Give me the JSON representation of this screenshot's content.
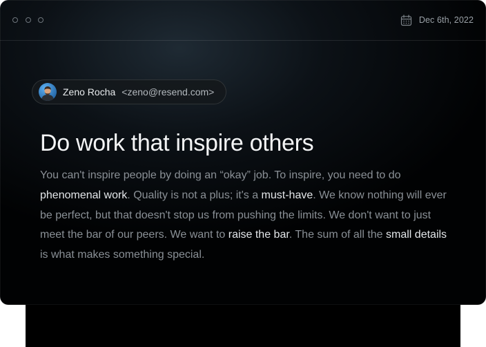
{
  "window": {
    "date": "Dec 6th, 2022"
  },
  "icons": {
    "traffic_lights": "window-control-dots",
    "calendar": "calendar-icon",
    "avatar": "avatar-image"
  },
  "sender": {
    "name": "Zeno Rocha",
    "email": "<zeno@resend.com>"
  },
  "email": {
    "headline": "Do work that inspire others",
    "body": [
      {
        "text": "You can't inspire people by doing an “okay” job. To inspire, you need to do ",
        "highlight": false
      },
      {
        "text": "phenomenal work",
        "highlight": true
      },
      {
        "text": ". Quality is not a plus; it's a ",
        "highlight": false
      },
      {
        "text": "must-have",
        "highlight": true
      },
      {
        "text": ". We know nothing will ever be perfect, but that doesn't stop us from pushing the limits. We don't want to just meet the bar of our peers. We want to ",
        "highlight": false
      },
      {
        "text": "raise the bar",
        "highlight": true
      },
      {
        "text": ". The sum of all the ",
        "highlight": false
      },
      {
        "text": "small details",
        "highlight": true
      },
      {
        "text": " is what makes something special.",
        "highlight": false
      }
    ]
  },
  "colors": {
    "background": "#010203",
    "headline": "#f3f4f5",
    "body_text": "#8a9096",
    "highlight_text": "#e4e7ea"
  }
}
